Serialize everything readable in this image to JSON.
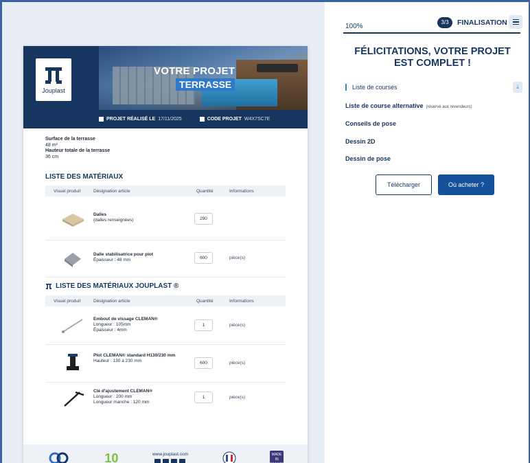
{
  "doc": {
    "logo_text": "Jouplast",
    "title_line1": "VOTRE PROJET",
    "title_line2": "TERRASSE",
    "project_label": "PROJET RÉALISÉ LE",
    "project_date": "17/11/2025",
    "code_label": "CODE PROJET",
    "code_value": "W4X7SC7E",
    "surface_label": "Surface de la terrasse",
    "surface_value": "48 m²",
    "height_label": "Hauteur totale de la terrasse",
    "height_value": "36 cm",
    "section1_title": "LISTE DES MATÉRIAUX",
    "section2_title": "LISTE DES MATÉRIAUX JOUPLAST ®",
    "columns": [
      "Visuel produit",
      "Désignation article",
      "Quantité",
      "Informations"
    ],
    "materials": [
      {
        "name": "Dalles",
        "lines": [
          "(dalles renseignées)"
        ],
        "qty": "290",
        "info": ""
      },
      {
        "name": "Dalle stabilisatrice pour plot",
        "lines": [
          "Épaisseur : 48 mm"
        ],
        "qty": "600",
        "info": "pièce(s)"
      }
    ],
    "jouplast_materials": [
      {
        "name": "Embout de vissage CLEMAN®",
        "lines": [
          "Longueur : 105mm",
          "Épaisseur : 4mm"
        ],
        "qty": "1",
        "info": "pièce(s)"
      },
      {
        "name": "Plot CLEMAN® standard H130/230 mm",
        "lines": [
          "Hauteur : 130 à 230 mm"
        ],
        "qty": "600",
        "info": "pièce(s)"
      },
      {
        "name": "Clé d'ajustement CLEMAN®",
        "lines": [
          "Longueur : 200 mm",
          "Longueur manche : 120 mm"
        ],
        "qty": "1",
        "info": "pièce(s)"
      }
    ],
    "footer_site": "www.jouplast.com",
    "footer_badge_ten": "10",
    "footer_badge_made": "MADE IN FRANCE"
  },
  "panel": {
    "progress_text": "100%",
    "progress_value": 1.0,
    "step_counter": "3/3",
    "step_name": "FINALISATION",
    "congrats": "FÉLICITATIONS, VOTRE PROJET EST COMPLET !",
    "links": {
      "shopping_list": "Liste de courses",
      "alt_list": "Liste de course alternative",
      "alt_list_note": "(réservé aux revendeurs)",
      "tips": "Conseils de pose",
      "drawing_2d": "Dessin 2D",
      "drawing_pose": "Dessin de pose"
    },
    "download_label": "Télécharger",
    "buy_label": "Où acheter ?"
  },
  "colors": {
    "brand": "#16365f",
    "accent": "#3a7bd5",
    "button_primary": "#16509a"
  }
}
